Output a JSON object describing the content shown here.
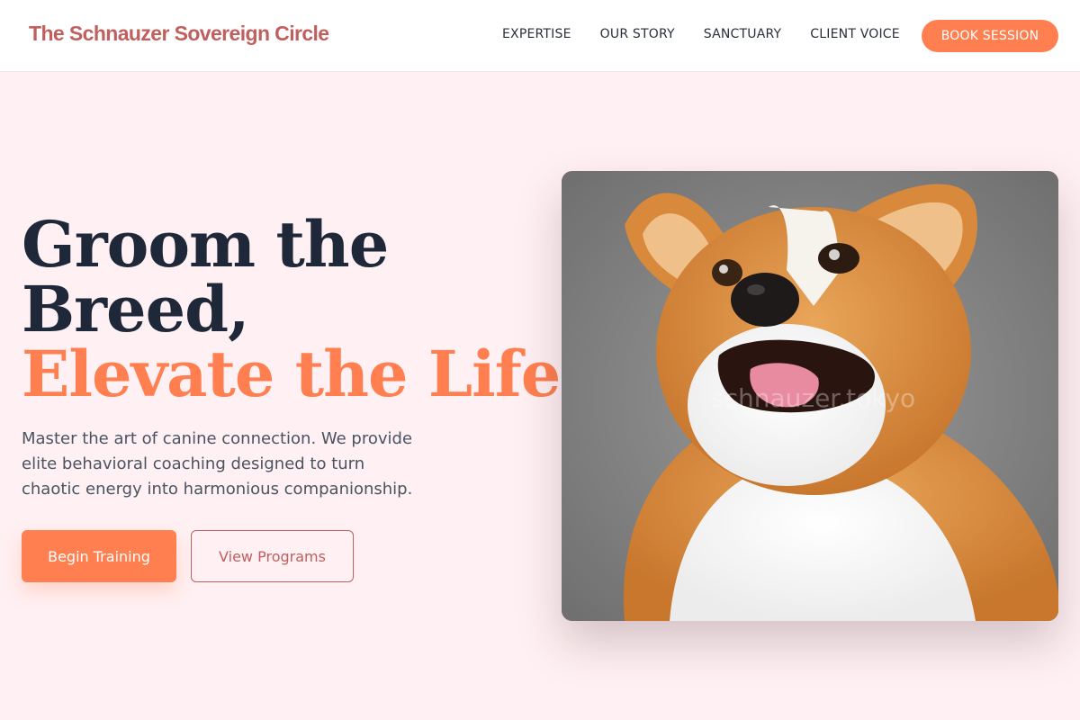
{
  "header": {
    "brand": "The Schnauzer Sovereign Circle",
    "nav": [
      {
        "label": "EXPERTISE"
      },
      {
        "label": "OUR STORY"
      },
      {
        "label": "SANCTUARY"
      },
      {
        "label": "CLIENT VOICE"
      }
    ],
    "cta_label": "BOOK SESSION"
  },
  "hero": {
    "headline_line1": "Groom the",
    "headline_line2": "Breed,",
    "headline_accent": "Elevate the Life.",
    "description": "Master the art of canine connection. We provide elite behavioral coaching designed to turn chaotic energy into harmonious companionship.",
    "primary_button": "Begin Training",
    "secondary_button": "View Programs",
    "image_watermark": "schnauzer.tokyo"
  },
  "colors": {
    "accent": "#ff7f50",
    "brand": "#c0605e",
    "background": "#fff0f3",
    "heading": "#1e2838"
  },
  "icons": {
    "hero_image": "corgi-photo"
  }
}
